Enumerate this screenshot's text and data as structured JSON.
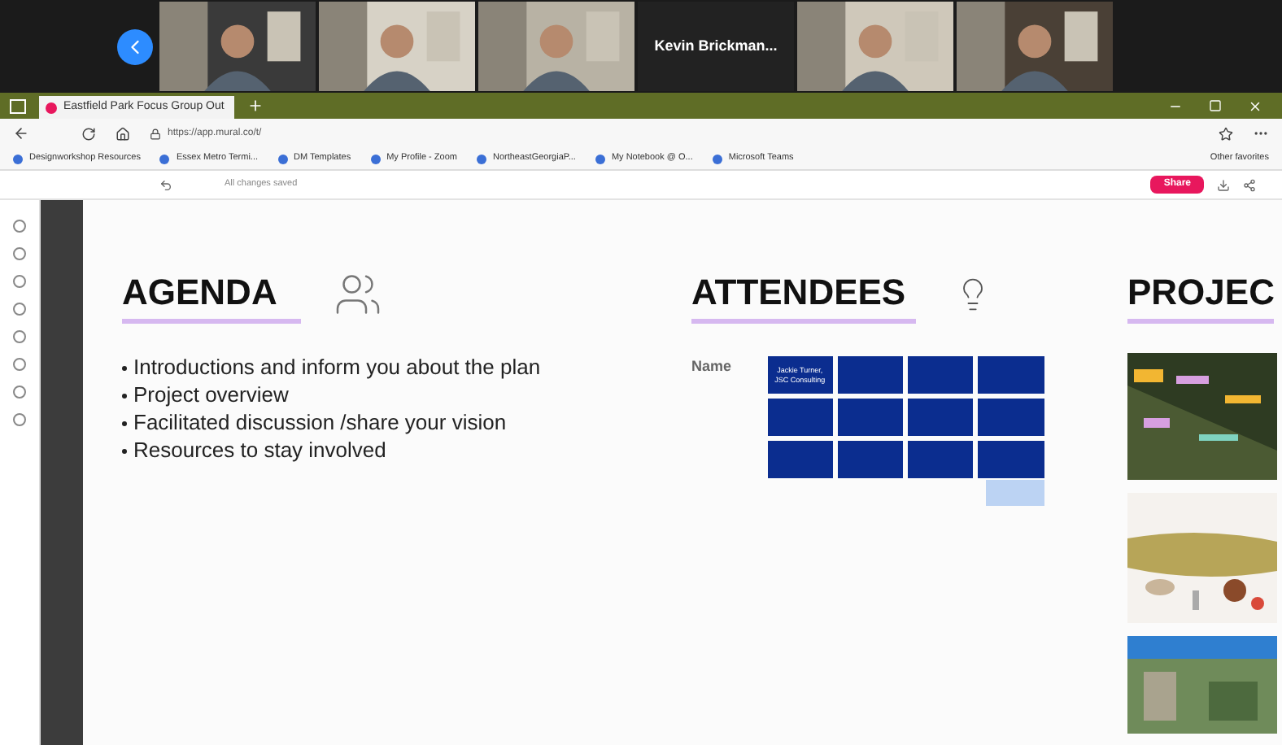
{
  "video_strip": {
    "tiles": [
      {
        "kind": "picture"
      },
      {
        "kind": "picture"
      },
      {
        "kind": "picture"
      },
      {
        "kind": "name",
        "label": "Kevin  Brickman..."
      },
      {
        "kind": "picture"
      },
      {
        "kind": "picture"
      }
    ]
  },
  "browser": {
    "tab": {
      "title": "Eastfield Park Focus Group Out",
      "selected": true
    },
    "address": "https://app.mural.co/t/",
    "bookmarks": [
      "Designworkshop Resources",
      "Essex Metro Termi...",
      "DM Templates",
      "My Profile - Zoom",
      "NortheastGeorgiaP...",
      "My Notebook @ O...",
      "Microsoft Teams"
    ],
    "other_bookmarks": "Other favorites"
  },
  "mural": {
    "save_status": "All changes saved",
    "share": "Share"
  },
  "agenda": {
    "title": "AGENDA",
    "items": [
      "Introductions and inform you about the plan",
      "Project overview",
      "Facilitated discussion /share your vision",
      "Resources to stay involved"
    ]
  },
  "attendees": {
    "title": "ATTENDEES",
    "label": "Name",
    "notes": [
      "Jackie Turner, JSC Consulting"
    ]
  },
  "project": {
    "title": "PROJEC"
  }
}
